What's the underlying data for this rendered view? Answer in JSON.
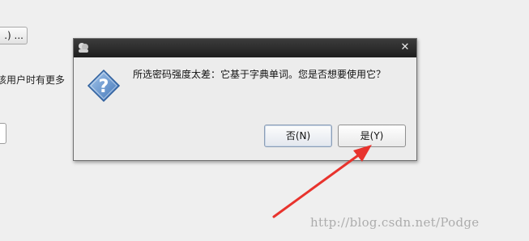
{
  "background": {
    "button_fragment": ".) ...",
    "text_fragment": "该用户时有更多",
    "box_fragment": ""
  },
  "dialog": {
    "title_icon": "app-icon",
    "close_label": "✕",
    "icon": "question-icon",
    "message": "所选密码强度太差：它基于字典单词。您是否想要使用它？",
    "buttons": {
      "no_label": "否(N)",
      "yes_label": "是(Y)"
    }
  },
  "annotation": {
    "arrow_color": "#e8332d"
  },
  "watermark": {
    "text": "http://blog.csdn.net/Podge"
  }
}
